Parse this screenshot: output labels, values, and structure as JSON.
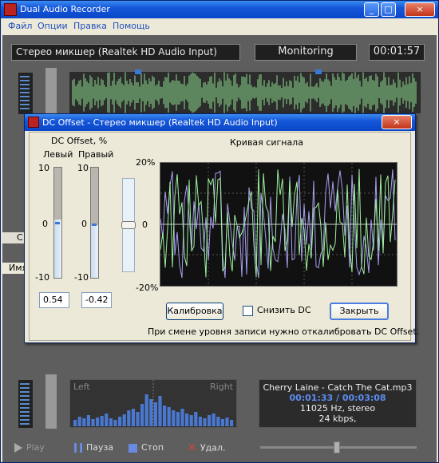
{
  "window": {
    "title": "Dual Audio Recorder"
  },
  "menu": [
    "Файл",
    "Опции",
    "Правка",
    "Помощь"
  ],
  "top": {
    "device": "Стерео микшер (Realtek HD Audio Input)",
    "mode": "Monitoring",
    "time": "00:01:57"
  },
  "background": {
    "col_header": "Имя",
    "tab_fragment": "С"
  },
  "dialog": {
    "title": "DC Offset - Стерео микшер (Realtek HD Audio Input)",
    "dc_label": "DC Offset, %",
    "left_label": "Левый",
    "right_label": "Правый",
    "scale": [
      "10",
      "0",
      "-10"
    ],
    "left_value": "0.54",
    "right_value": "-0.42",
    "curve_title": "Кривая сигнала",
    "y_top": "20%",
    "y_mid": "0",
    "y_bottom": "-20%",
    "calibrate": "Калибровка",
    "reduce_dc": "Снизить DC",
    "close": "Закрыть",
    "note": "При смене уровня записи нужно откалибровать DC Offset."
  },
  "spectrum": {
    "left": "Left",
    "right": "Right"
  },
  "player": {
    "track": "Cherry Laine - Catch The Cat.mp3",
    "position": "00:01:33 / 00:03:08",
    "format": "11025 Hz, stereo",
    "bitrate": "24 kbps,"
  },
  "controls": {
    "play": "Play",
    "pause": "Пауза",
    "stop": "Стоп",
    "delete": "Удал."
  },
  "colors": {
    "titlebar": "#0a47c9",
    "accent": "#4a7de0",
    "wave": "#8fe08f"
  }
}
